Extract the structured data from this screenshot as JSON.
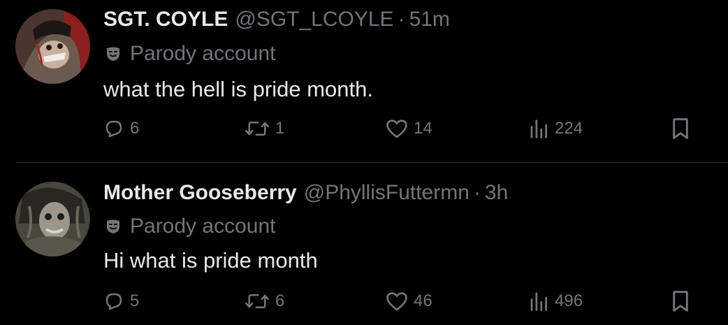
{
  "tweets": [
    {
      "author_name": "SGT. COYLE",
      "handle": "@SGT_LCOYLE",
      "separator": "·",
      "time": "51m",
      "label": "Parody account",
      "text": "what the hell is pride month.",
      "replies": "6",
      "reposts": "1",
      "likes": "14",
      "views": "224"
    },
    {
      "author_name": "Mother Gooseberry",
      "handle": "@PhyllisFuttermn",
      "separator": "·",
      "time": "3h",
      "label": "Parody account",
      "text": "Hi what is pride month",
      "replies": "5",
      "reposts": "6",
      "likes": "46",
      "views": "496"
    }
  ],
  "icons": {
    "parody": "theater-mask-icon",
    "reply": "reply-icon",
    "repost": "repost-icon",
    "like": "heart-icon",
    "views": "views-icon",
    "bookmark": "bookmark-icon"
  },
  "colors": {
    "background": "#000000",
    "primary_text": "#e7e9ea",
    "secondary_text": "#71767b",
    "divider": "#2f3336"
  }
}
